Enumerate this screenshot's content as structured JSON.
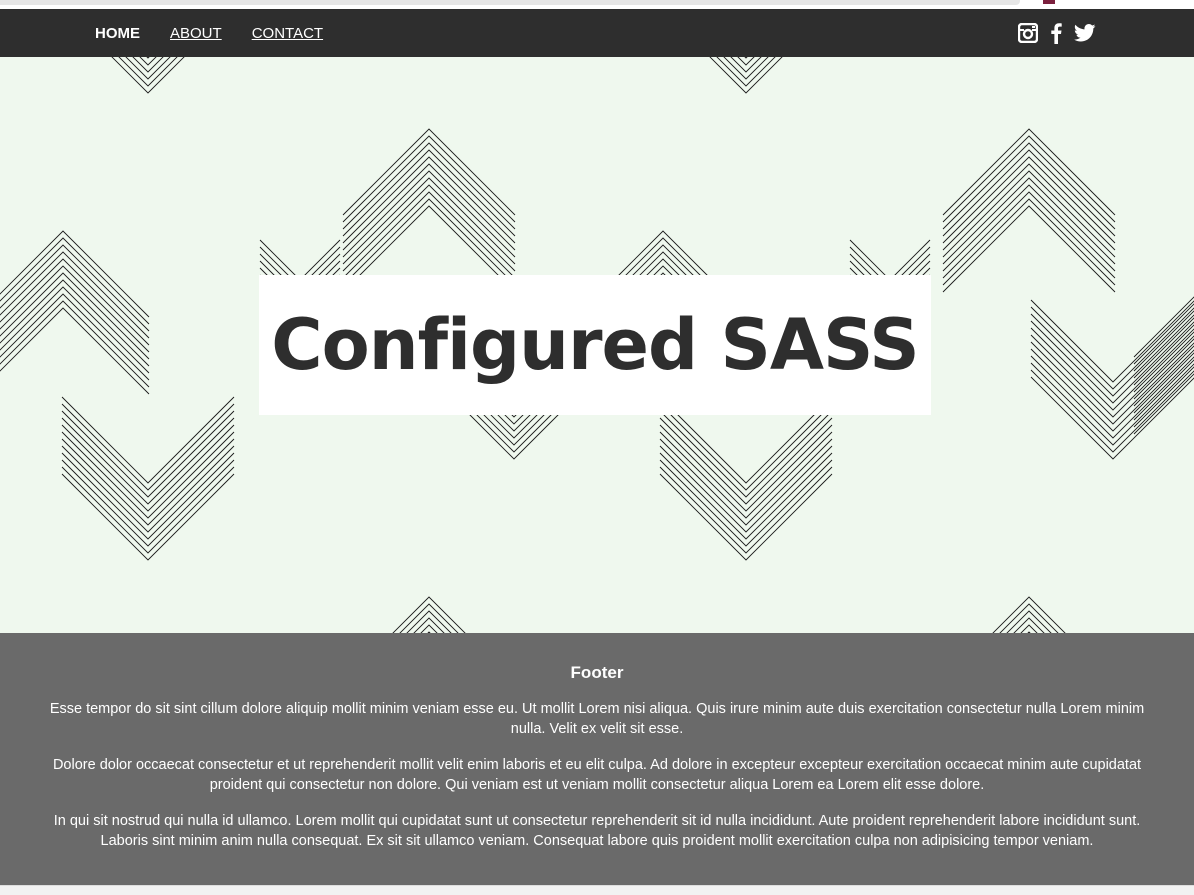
{
  "nav": {
    "links": [
      {
        "label": "HOME"
      },
      {
        "label": "ABOUT"
      },
      {
        "label": "CONTACT"
      }
    ],
    "social_icons": [
      "instagram-icon",
      "facebook-icon",
      "twitter-icon"
    ]
  },
  "hero": {
    "title": "Configured SASS"
  },
  "footer": {
    "heading": "Footer",
    "paragraphs": [
      "Esse tempor do sit sint cillum dolore aliquip mollit minim veniam esse eu. Ut mollit Lorem nisi aliqua. Quis irure minim aute duis exercitation consectetur nulla Lorem minim nulla. Velit ex velit sit esse.",
      "Dolore dolor occaecat consectetur et ut reprehenderit mollit velit enim laboris et eu elit culpa. Ad dolore in excepteur excepteur exercitation occaecat minim aute cupidatat proident qui consectetur non dolore. Qui veniam est ut veniam mollit consectetur aliqua Lorem ea Lorem elit esse dolore.",
      "In qui sit nostrud qui nulla id ullamco. Lorem mollit qui cupidatat sunt ut consectetur reprehenderit sit id nulla incididunt. Aute proident reprehenderit labore incididunt sunt. Laboris sint minim anim nulla consequat. Ex sit sit ullamco veniam. Consequat labore quis proident mollit exercitation culpa non adipisicing tempor veniam."
    ]
  },
  "colors": {
    "navbar": "#2e2e2e",
    "hero_bg": "#eff8ee",
    "footer_bg": "#6a6a6a",
    "title_text": "#2e2e2e"
  }
}
